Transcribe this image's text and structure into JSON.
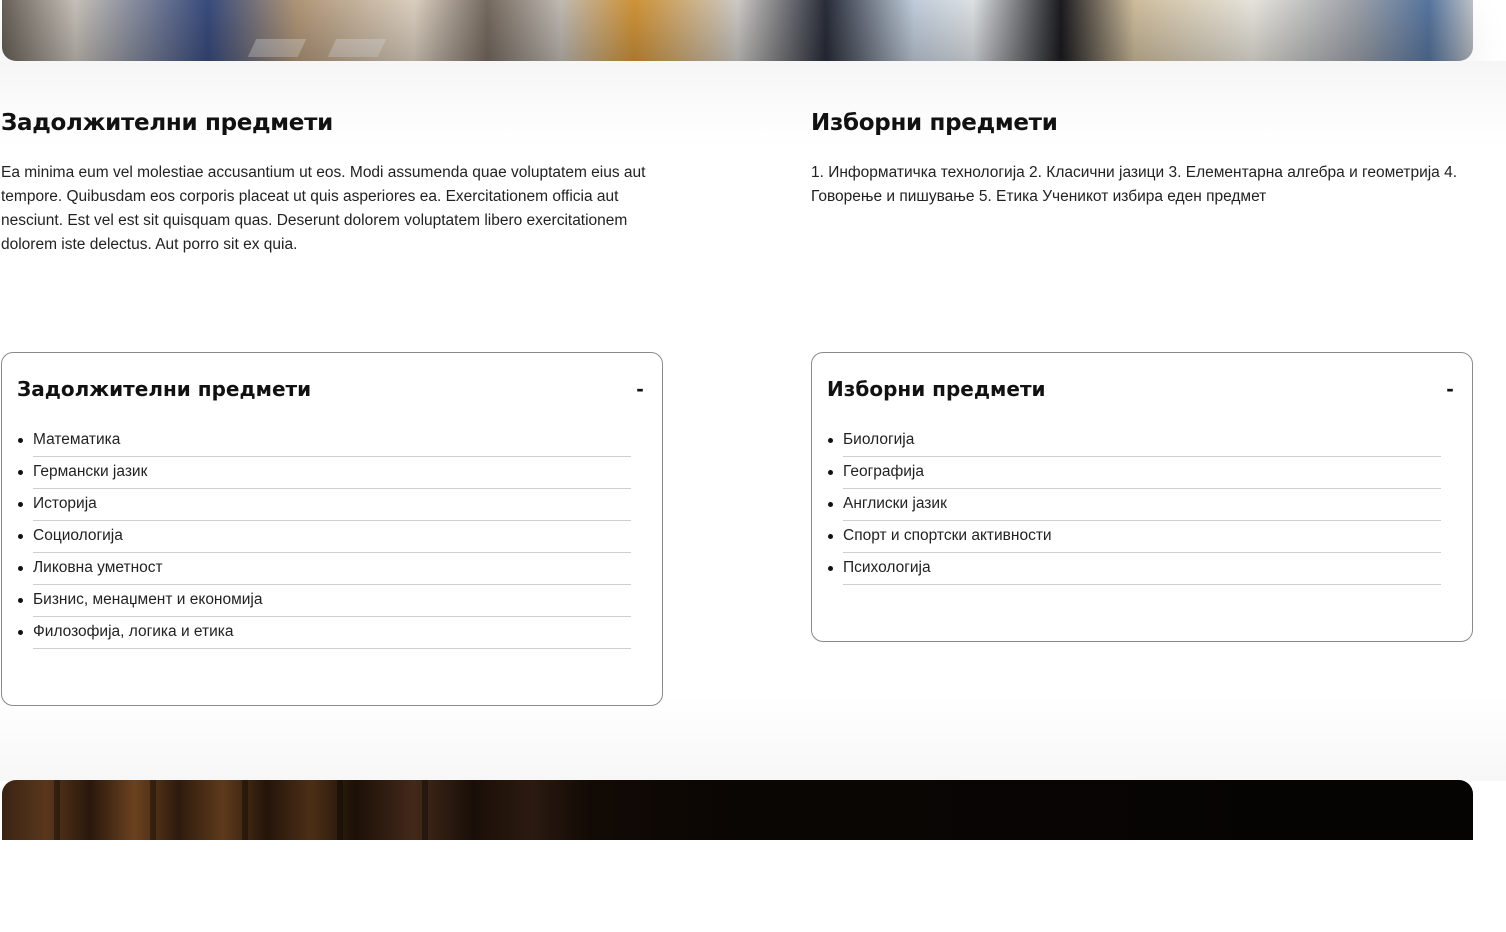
{
  "mandatory": {
    "title": "Задолжителни предмети",
    "description": "Ea minima eum vel molestiae accusantium ut eos. Modi assumenda quae voluptatem eius aut tempore. Quibusdam eos corporis placeat ut quis asperiores ea. Exercitationem officia aut nesciunt. Est vel est sit quisquam quas. Deserunt dolorem voluptatem libero exercitationem dolorem iste delectus. Aut porro sit ex quia."
  },
  "elective": {
    "title": "Изборни предмети",
    "description": "1. Информатичка технологија 2. Класични јазици 3. Елементарна алгебра и геометрија 4. Говорење и пишување 5. Етика Ученикот избира еден предмет"
  },
  "mandatory_card": {
    "title": "Задолжителни предмети",
    "toggle": "-",
    "items": [
      "Математика",
      "Германски јазик",
      "Историја",
      "Социологија",
      "Ликовна уметност",
      "Бизнис, менаџмент и економија",
      "Филозофија, логика и етика"
    ]
  },
  "elective_card": {
    "title": "Изборни предмети",
    "toggle": "-",
    "items": [
      "Биологија",
      "Географија",
      "Англиски јазик",
      "Спорт и спортски активности",
      "Психологија"
    ]
  }
}
